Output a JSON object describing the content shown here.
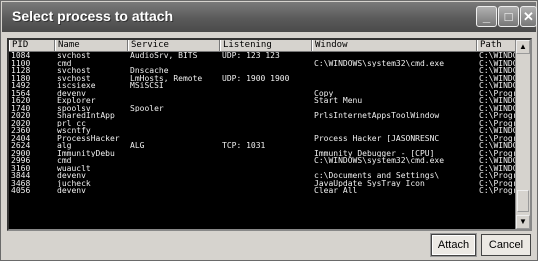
{
  "window": {
    "title": "Select process to attach"
  },
  "titlebar_buttons": {
    "minimize": "_",
    "maximize": "□",
    "close": "✕"
  },
  "columns": [
    "PID",
    "Name",
    "Service",
    "Listening",
    "Window",
    "Path"
  ],
  "processes": [
    [
      "1084",
      "svchost",
      "AudioSrv, BITS",
      "UDP: 123 123",
      "",
      "C:\\WINDO"
    ],
    [
      "1100",
      "cmd",
      "",
      "",
      "C:\\WINDOWS\\system32\\cmd.exe",
      "C:\\WINDO"
    ],
    [
      "1128",
      "svchost",
      "Dnscache",
      "",
      "",
      "C:\\WINDO"
    ],
    [
      "1180",
      "svchost",
      "LmHosts, Remote",
      "UDP: 1900 1900",
      "",
      "C:\\WINDO"
    ],
    [
      "1492",
      "iscsiexe",
      "MSiSCSI",
      "",
      "",
      "C:\\WINDO"
    ],
    [
      "1564",
      "devenv",
      "",
      "",
      "Copy",
      "C:\\Progr"
    ],
    [
      "1620",
      "Explorer",
      "",
      "",
      "Start Menu",
      "C:\\WINDO"
    ],
    [
      "1740",
      "spoolsv",
      "Spooler",
      "",
      "",
      "C:\\WINDO"
    ],
    [
      "2020",
      "SharedIntApp",
      "",
      "",
      "PrlsInternetAppsToolWindow",
      "C:\\Progr"
    ],
    [
      "2020",
      "prl_cc",
      "",
      "",
      "",
      "C:\\Progr"
    ],
    [
      "2360",
      "wscntfy",
      "",
      "",
      "",
      "C:\\WINDO"
    ],
    [
      "2404",
      "ProcessHacker",
      "",
      "",
      "Process Hacker [JASONRESNC",
      "C:\\Progr"
    ],
    [
      "2624",
      "alg",
      "ALG",
      "TCP: 1031",
      "",
      "C:\\WINDO"
    ],
    [
      "2900",
      "ImmunityDebu",
      "",
      "",
      "Immunity Debugger - [CPU]",
      "C:\\Progr"
    ],
    [
      "2996",
      "cmd",
      "",
      "",
      "C:\\WINDOWS\\system32\\cmd.exe",
      "C:\\WINDO"
    ],
    [
      "3160",
      "wuauclt",
      "",
      "",
      "",
      "C:\\WINDO"
    ],
    [
      "3844",
      "devenv",
      "",
      "",
      "c:\\Documents and Settings\\",
      "C:\\Progr"
    ],
    [
      "3468",
      "jucheck",
      "",
      "",
      "JavaUpdate SysTray Icon",
      "C:\\Progr"
    ],
    [
      "4056",
      "devenv",
      "",
      "",
      "Clear All",
      "C:\\Progr"
    ]
  ],
  "scrollbar": {
    "up": "▲",
    "down": "▼"
  },
  "buttons": {
    "attach": "Attach",
    "cancel": "Cancel"
  }
}
